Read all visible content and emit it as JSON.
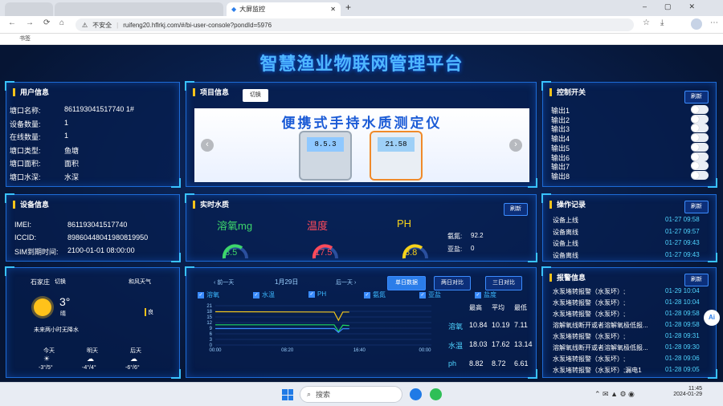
{
  "browser": {
    "tabs": [
      {
        "label": ""
      },
      {
        "label": ""
      },
      {
        "label": "大屏监控"
      }
    ],
    "new_tab": "+",
    "security": "不安全",
    "url": "ruifeng20.hflrkj.com/#/bi-user-console?pondId=5976",
    "bookmarks": "书签"
  },
  "title": "智慧渔业物联网管理平台",
  "user_info": {
    "heading": "用户信息",
    "rows": [
      {
        "k": "塘口名称:",
        "v": "861193041517740 1#"
      },
      {
        "k": "设备数量:",
        "v": "1"
      },
      {
        "k": "在线数量:",
        "v": "1"
      },
      {
        "k": "塘口类型:",
        "v": "鱼塘"
      },
      {
        "k": "塘口面积:",
        "v": "面积"
      },
      {
        "k": "塘口水深:",
        "v": "水深"
      }
    ]
  },
  "device_info": {
    "heading": "设备信息",
    "rows": [
      {
        "k": "IMEI:",
        "v": "861193041517740"
      },
      {
        "k": "ICCID:",
        "v": "89860448041980819950"
      },
      {
        "k": "SIM到期时间:",
        "v": "2100-01-01 08:00:00"
      }
    ]
  },
  "weather": {
    "city": "石家庄",
    "switch": "切换",
    "wind": "和风天气",
    "temp": "3°",
    "cond": "晴",
    "aqi": "良",
    "forecast_note": "未来两小时无降水",
    "days": [
      {
        "day": "今天",
        "range": "-3°/5°"
      },
      {
        "day": "明天",
        "range": "-4°/4°"
      },
      {
        "day": "后天",
        "range": "-6°/6°"
      }
    ]
  },
  "project": {
    "heading": "项目信息",
    "switch_btn": "切换",
    "banner_text": "便携式手持水质测定仪",
    "meter1": "8.5.3",
    "meter2": "21.58",
    "prev": "‹",
    "next": "›"
  },
  "water": {
    "heading": "实时水质",
    "refresh": "刷新",
    "items": [
      {
        "label": "溶氧mg",
        "value": "8.5",
        "color": "#3dd66b"
      },
      {
        "label": "温度",
        "value": "17.5",
        "color": "#ff4a5a"
      },
      {
        "label": "PH",
        "value": "8.8",
        "color": "#f6d21a"
      }
    ],
    "ammonia_label": "氨氮:",
    "ammonia": "92.2",
    "nitrite_label": "亚盐:",
    "nitrite": "0"
  },
  "trend": {
    "prev": "前一天",
    "date": "1月29日",
    "next": "后一天",
    "btn_single": "单日数据",
    "btn_two": "两日对比",
    "btn_three": "三日对比",
    "checks": [
      "溶氧",
      "水温",
      "PH",
      "氨氮",
      "亚盐",
      "盐度"
    ],
    "stats_head": [
      "最高",
      "平均",
      "最低"
    ],
    "stats": [
      {
        "name": "溶氧",
        "max": "10.84",
        "avg": "10.19",
        "min": "7.11"
      },
      {
        "name": "水温",
        "max": "18.03",
        "avg": "17.62",
        "min": "13.14"
      },
      {
        "name": "ph",
        "max": "8.82",
        "avg": "8.72",
        "min": "6.61"
      }
    ]
  },
  "chart_data": {
    "type": "line",
    "x_ticks": [
      "00:00",
      "08:20",
      "16:40",
      "00:00"
    ],
    "y_ticks": [
      "0",
      "3",
      "6",
      "9",
      "12",
      "15",
      "18",
      "21"
    ],
    "ylim": [
      0,
      21
    ],
    "series": [
      {
        "name": "溶氧",
        "color": "#1ed760",
        "points": [
          [
            0,
            10.8
          ],
          [
            0.55,
            10.8
          ],
          [
            0.57,
            7.2
          ],
          [
            0.59,
            10.6
          ],
          [
            0.62,
            10.4
          ]
        ]
      },
      {
        "name": "水温",
        "color": "#f0c419",
        "points": [
          [
            0,
            17.8
          ],
          [
            0.55,
            17.6
          ],
          [
            0.57,
            13.2
          ],
          [
            0.59,
            17.6
          ],
          [
            0.62,
            17.6
          ]
        ]
      },
      {
        "name": "PH",
        "color": "#3a8cff",
        "points": [
          [
            0,
            8.8
          ],
          [
            0.55,
            8.8
          ],
          [
            0.57,
            6.7
          ],
          [
            0.59,
            8.7
          ],
          [
            0.62,
            8.7
          ]
        ]
      }
    ]
  },
  "control": {
    "heading": "控制开关",
    "refresh": "刷新",
    "outputs": [
      "输出1",
      "输出2",
      "输出3",
      "输出4",
      "输出5",
      "输出6",
      "输出7",
      "输出8"
    ]
  },
  "ops": {
    "heading": "操作记录",
    "refresh": "刷新",
    "rows": [
      {
        "t": "设备上线",
        "time": "01-27 09:58"
      },
      {
        "t": "设备离线",
        "time": "01-27 09:57"
      },
      {
        "t": "设备上线",
        "time": "01-27 09:43"
      },
      {
        "t": "设备离线",
        "time": "01-27 09:43"
      }
    ]
  },
  "alarm": {
    "heading": "报警信息",
    "refresh": "刷新",
    "rows": [
      {
        "t": "水泵堵转报警（水泵坏）;",
        "time": "01-29 10:04"
      },
      {
        "t": "水泵堵转报警（水泵坏）;",
        "time": "01-28 10:04"
      },
      {
        "t": "水泵堵转报警（水泵坏）;",
        "time": "01-28 09:58"
      },
      {
        "t": "溶解氧线断开或者溶解氧极低报...",
        "time": "01-28 09:58"
      },
      {
        "t": "水泵堵转报警（水泵坏）;",
        "time": "01-28 09:31"
      },
      {
        "t": "溶解氧线断开或者溶解氧极低报...",
        "time": "01-28 09:30"
      },
      {
        "t": "水泵堵转报警（水泵坏）;",
        "time": "01-28 09:06"
      },
      {
        "t": "水泵堵转报警（水泵坏）;漏电1",
        "time": "01-28 09:05"
      }
    ]
  },
  "taskbar": {
    "search": "搜索",
    "time": "11:45",
    "date": "2024-01-29"
  },
  "ai_badge": "Ai"
}
